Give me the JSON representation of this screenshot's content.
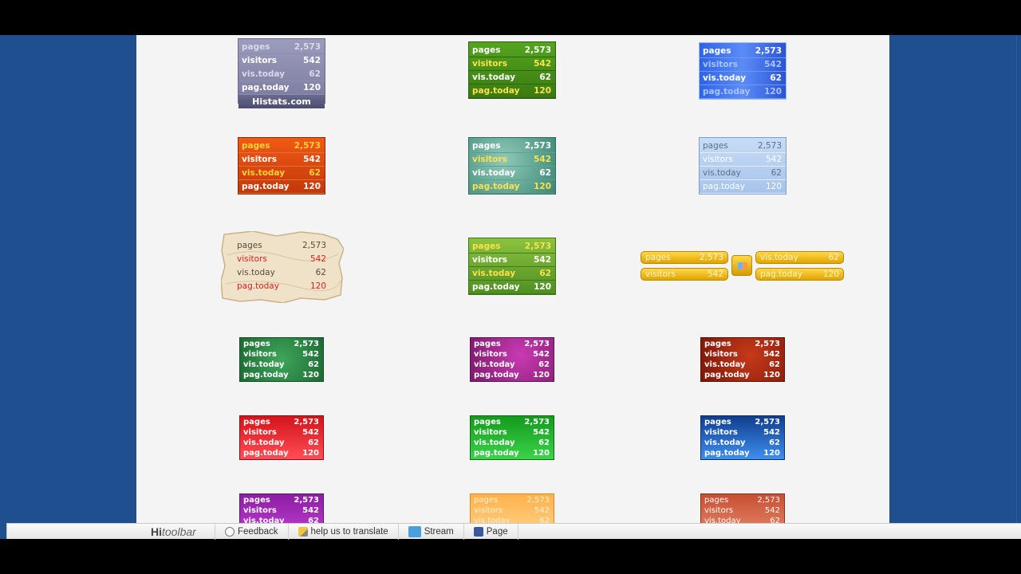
{
  "labels": {
    "pages": "pages",
    "visitors": "visitors",
    "vis_today": "vis.today",
    "pag_today": "pag.today"
  },
  "stats": {
    "pages": "2,573",
    "visitors": "542",
    "vis_today": "62",
    "pag_today": "120"
  },
  "histats_footer": "Histats.com",
  "toolbar": {
    "brand_hi": "Hi",
    "brand_rest": "toolbar",
    "items": [
      "Feedback",
      "help us to translate",
      "Stream",
      "Page"
    ]
  },
  "colors": {
    "background_blue": "#1f4f8e",
    "page_bg": "#f4f4f4"
  }
}
